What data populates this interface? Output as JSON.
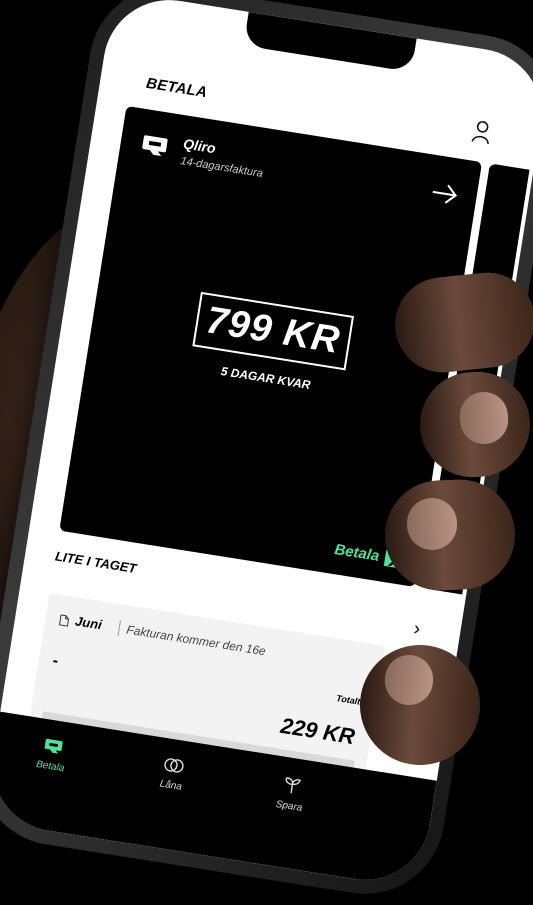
{
  "header": {
    "title": "BETALA",
    "profile_icon": "user-icon"
  },
  "card": {
    "provider": "Qliro",
    "invoice_type": "14-dagarsfaktura",
    "amount": "799 KR",
    "days_left": "5 DAGAR KVAR",
    "pay_label": "Betala",
    "accent_color": "#4de29a"
  },
  "section": {
    "title": "LITE I TAGET"
  },
  "invoice": {
    "month": "Juni",
    "note": "Fakturan kommer den 16e",
    "dash": "-",
    "total_label": "Totalt",
    "total_amount": "229 KR",
    "progress": 0
  },
  "tabs": [
    {
      "label": "Betala",
      "icon": "qliro-tab-icon",
      "active": true
    },
    {
      "label": "Låna",
      "icon": "rings-icon",
      "active": false
    },
    {
      "label": "Spara",
      "icon": "sprout-icon",
      "active": false
    }
  ]
}
